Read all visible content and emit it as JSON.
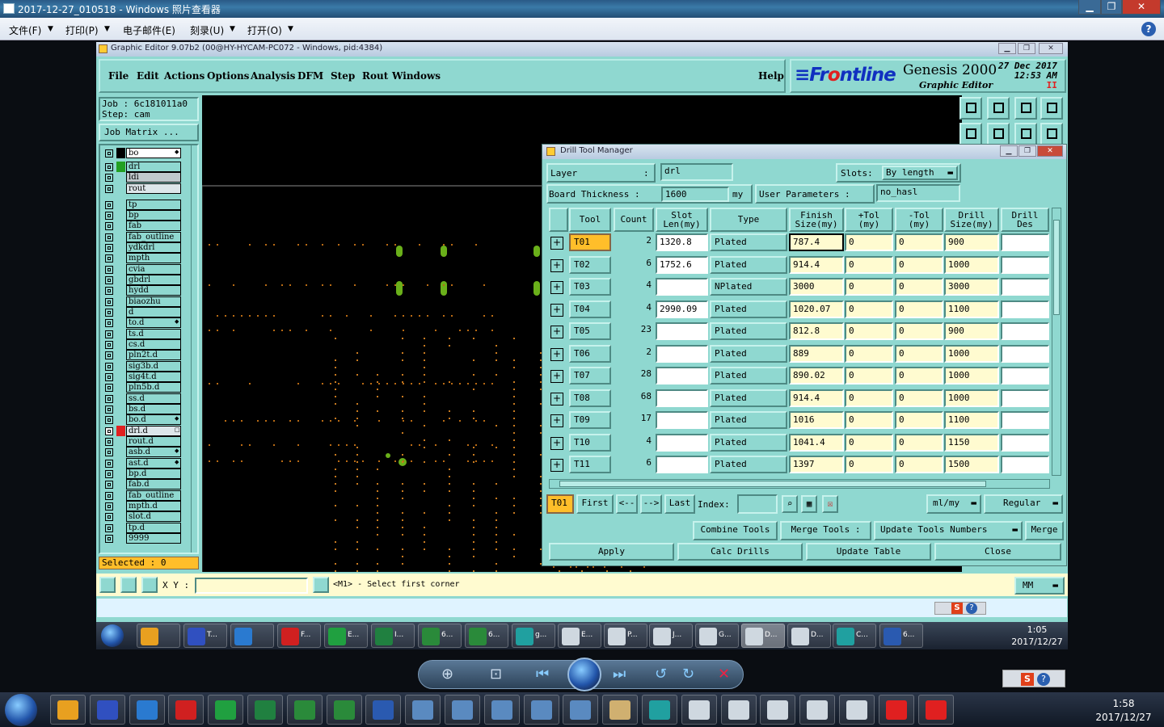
{
  "photo_viewer": {
    "title": "2017-12-27_010518 - Windows 照片查看器",
    "menu": [
      {
        "label": "文件(F)"
      },
      {
        "label": "打印(P)"
      },
      {
        "label": "电子邮件(E)"
      },
      {
        "label": "刻录(U)"
      },
      {
        "label": "打开(O)"
      }
    ],
    "help": "?"
  },
  "genesis": {
    "window_title": "Graphic Editor 9.07b2 (00@HY-HYCAM-PC072 - Windows, pid:4384)",
    "menu": [
      "File",
      "Edit",
      "Actions",
      "Options",
      "Analysis",
      "DFM",
      "Step",
      "Rout",
      "Windows"
    ],
    "help": "Help",
    "logo": {
      "brand_a": "≡Fr",
      "brand_b": "o",
      "brand_c": "ntline",
      "product": "Genesis 2000",
      "subtitle": "Graphic Editor",
      "date_line1": "27 Dec 2017",
      "date_line2": "12:53 AM",
      "pause": "II"
    },
    "job_line": "Job : 6c181011a0",
    "step_line": "Step: cam",
    "job_matrix": "Job Matrix ...",
    "selected": "Selected : 0",
    "xy_label": "X Y :",
    "xy_value": "",
    "prompt": "<M1> - Select first corner",
    "units": "MM",
    "layers": [
      {
        "name": "bo",
        "color": "#000000",
        "dot": "◆"
      },
      {
        "name": "drl",
        "color": "#22a022",
        "dot": ""
      },
      {
        "name": "ldi",
        "color": "",
        "dot": ""
      },
      {
        "name": "rout",
        "color": "",
        "dot": ""
      },
      {
        "name": "tp",
        "color": "",
        "dot": ""
      },
      {
        "name": "bp",
        "color": "",
        "dot": ""
      },
      {
        "name": "fab",
        "color": "",
        "dot": ""
      },
      {
        "name": "fab_outline",
        "color": "",
        "dot": ""
      },
      {
        "name": "ydkdrl",
        "color": "",
        "dot": ""
      },
      {
        "name": "mpth",
        "color": "",
        "dot": ""
      },
      {
        "name": "cvia",
        "color": "",
        "dot": ""
      },
      {
        "name": "gbdrl",
        "color": "",
        "dot": ""
      },
      {
        "name": "hydd",
        "color": "",
        "dot": ""
      },
      {
        "name": "biaozhu",
        "color": "",
        "dot": ""
      },
      {
        "name": "d",
        "color": "",
        "dot": ""
      },
      {
        "name": "to.d",
        "color": "",
        "dot": "◆"
      },
      {
        "name": "ts.d",
        "color": "",
        "dot": ""
      },
      {
        "name": "cs.d",
        "color": "",
        "dot": ""
      },
      {
        "name": "pln2t.d",
        "color": "",
        "dot": ""
      },
      {
        "name": "sig3b.d",
        "color": "",
        "dot": ""
      },
      {
        "name": "sig4t.d",
        "color": "",
        "dot": ""
      },
      {
        "name": "pln5b.d",
        "color": "",
        "dot": ""
      },
      {
        "name": "ss.d",
        "color": "",
        "dot": ""
      },
      {
        "name": "bs.d",
        "color": "",
        "dot": ""
      },
      {
        "name": "bo.d",
        "color": "",
        "dot": "◆"
      },
      {
        "name": "drl.d",
        "color": "#e02020",
        "dot": "□"
      },
      {
        "name": "rout.d",
        "color": "",
        "dot": ""
      },
      {
        "name": "asb.d",
        "color": "",
        "dot": "◆"
      },
      {
        "name": "ast.d",
        "color": "",
        "dot": "◆"
      },
      {
        "name": "bp.d",
        "color": "",
        "dot": ""
      },
      {
        "name": "fab.d",
        "color": "",
        "dot": ""
      },
      {
        "name": "fab_outline",
        "color": "",
        "dot": ""
      },
      {
        "name": "mpth.d",
        "color": "",
        "dot": ""
      },
      {
        "name": "slot.d",
        "color": "",
        "dot": ""
      },
      {
        "name": "tp.d",
        "color": "",
        "dot": ""
      },
      {
        "name": "9999",
        "color": "",
        "dot": ""
      }
    ]
  },
  "drill_tool_manager": {
    "title": "Drill Tool Manager",
    "layer_label": "Layer",
    "layer_sep": ":",
    "layer_value": "drl",
    "slots_label": "Slots:",
    "slots_value": "By length",
    "board_thickness_label": "Board Thickness :",
    "board_thickness_value": "1600",
    "board_thickness_unit": "my",
    "user_params_label": "User Parameters :",
    "user_params_value": "no_hasl",
    "columns": {
      "tool": "Tool",
      "count": "Count",
      "slot": "Slot\nLen(my)",
      "type": "Type",
      "finish": "Finish\nSize(my)",
      "ptol": "+Tol\n(my)",
      "mtol": "-Tol\n(my)",
      "drill": "Drill\nSize(my)",
      "des": "Drill\nDes"
    },
    "rows": [
      {
        "tool": "T01",
        "count": "2",
        "slot": "1320.8",
        "type": "Plated",
        "finish": "787.4",
        "ptol": "0",
        "mtol": "0",
        "drill": "900",
        "des": ""
      },
      {
        "tool": "T02",
        "count": "6",
        "slot": "1752.6",
        "type": "Plated",
        "finish": "914.4",
        "ptol": "0",
        "mtol": "0",
        "drill": "1000",
        "des": ""
      },
      {
        "tool": "T03",
        "count": "4",
        "slot": "",
        "type": "NPlated",
        "finish": "3000",
        "ptol": "0",
        "mtol": "0",
        "drill": "3000",
        "des": ""
      },
      {
        "tool": "T04",
        "count": "4",
        "slot": "2990.09",
        "type": "Plated",
        "finish": "1020.07",
        "ptol": "0",
        "mtol": "0",
        "drill": "1100",
        "des": ""
      },
      {
        "tool": "T05",
        "count": "23",
        "slot": "",
        "type": "Plated",
        "finish": "812.8",
        "ptol": "0",
        "mtol": "0",
        "drill": "900",
        "des": ""
      },
      {
        "tool": "T06",
        "count": "2",
        "slot": "",
        "type": "Plated",
        "finish": "889",
        "ptol": "0",
        "mtol": "0",
        "drill": "1000",
        "des": ""
      },
      {
        "tool": "T07",
        "count": "28",
        "slot": "",
        "type": "Plated",
        "finish": "890.02",
        "ptol": "0",
        "mtol": "0",
        "drill": "1000",
        "des": ""
      },
      {
        "tool": "T08",
        "count": "68",
        "slot": "",
        "type": "Plated",
        "finish": "914.4",
        "ptol": "0",
        "mtol": "0",
        "drill": "1000",
        "des": ""
      },
      {
        "tool": "T09",
        "count": "17",
        "slot": "",
        "type": "Plated",
        "finish": "1016",
        "ptol": "0",
        "mtol": "0",
        "drill": "1100",
        "des": ""
      },
      {
        "tool": "T10",
        "count": "4",
        "slot": "",
        "type": "Plated",
        "finish": "1041.4",
        "ptol": "0",
        "mtol": "0",
        "drill": "1150",
        "des": ""
      },
      {
        "tool": "T11",
        "count": "6",
        "slot": "",
        "type": "Plated",
        "finish": "1397",
        "ptol": "0",
        "mtol": "0",
        "drill": "1500",
        "des": ""
      }
    ],
    "nav": {
      "current_tool": "T01",
      "first": "First",
      "prev": "<--",
      "next": "-->",
      "last": "Last",
      "index_label": "Index:",
      "index_value": "",
      "units": "ml/my",
      "mode": "Regular"
    },
    "actions": {
      "combine": "Combine Tools",
      "merge_label": "Merge Tools :",
      "update_numbers": "Update Tools Numbers",
      "merge": "Merge",
      "apply": "Apply",
      "calc": "Calc Drills",
      "update_table": "Update Table",
      "close": "Close"
    }
  },
  "inner_taskbar": {
    "items": [
      {
        "label": "",
        "color": "#e8a020"
      },
      {
        "label": "T...",
        "color": "#3050c0"
      },
      {
        "label": "",
        "color": "#2a7ad0"
      },
      {
        "label": "F...",
        "color": "#d02020"
      },
      {
        "label": "E...",
        "color": "#20a040"
      },
      {
        "label": "I...",
        "color": "#208040"
      },
      {
        "label": "6...",
        "color": "#2a8a3a"
      },
      {
        "label": "6...",
        "color": "#2a8a3a"
      },
      {
        "label": "g...",
        "color": "#20a0a0"
      },
      {
        "label": "E...",
        "color": "#cfd8e0"
      },
      {
        "label": "P...",
        "color": "#cfd8e0"
      },
      {
        "label": "J...",
        "color": "#cfd8e0"
      },
      {
        "label": "G...",
        "color": "#cfd8e0"
      },
      {
        "label": "D...",
        "color": "#cfd8e0"
      },
      {
        "label": "D...",
        "color": "#cfd8e0"
      },
      {
        "label": "C...",
        "color": "#20a0a0"
      },
      {
        "label": "6...",
        "color": "#2a5ab0"
      }
    ],
    "time": "1:05",
    "date": "2017/12/27"
  },
  "outer_taskbar": {
    "time": "1:58",
    "date": "2017/12/27"
  }
}
